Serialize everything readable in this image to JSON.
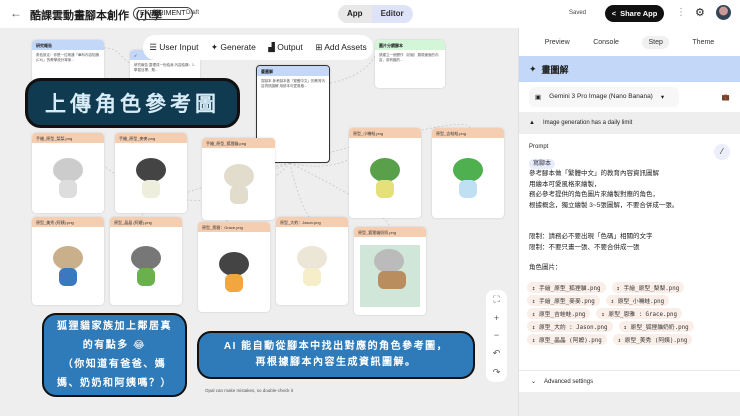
{
  "header": {
    "back": "←",
    "title": "酷課雲動畫腳本創作（小學",
    "badge": "EXPERIMENT",
    "draft": "Draft",
    "app": "App",
    "editor": "Editor",
    "saved": "Saved",
    "share": "Share App",
    "more": "⋮",
    "settings": "⚙"
  },
  "toolbar": {
    "user_input": "User Input",
    "generate": "Generate",
    "output": "Output",
    "add_assets": "Add Assets"
  },
  "canvas": {
    "banner": "上傳角色參考圖",
    "nodes": [
      {
        "title": "研究報告",
        "body": "角色設定：你是一位精通「華科內容知識(CK)」的教學設計專家..."
      },
      {
        "title": "✓",
        "body": "研究報告 整理成一份給我 內容結構：1.學習目標、題..."
      },
      {
        "title": "畫圖解",
        "body": "寫腳本 參考腳本做「繁體中文」的教育內容資訊圖解 用繪本可愛風格..."
      },
      {
        "title": "圖片分鏡腳本",
        "body": "請建立一個實作（初級）展現畫面的內容，用有趣的..."
      }
    ],
    "images": [
      "手繪_原型_梨梨.png",
      "手繪_原型_麥麥.png",
      "手繪_原型_狐狸貓.png",
      "原型_小嘰蛙.png",
      "原型_吉蛙蛙.png",
      "原型_美秀 (阿姨).png",
      "原型_晶晶 (阿嬤).png",
      "原型_恩雅：Grace.png",
      "原型_大約：Jason.png",
      "原型_狐狸貓奶奶.png"
    ],
    "callout1": [
      "狐狸貓家族加上鄰居真",
      "的有點多 😂",
      "（你知道有爸爸、媽",
      "媽、奶奶和阿姨嗎？）"
    ],
    "callout2": [
      "AI 能自動從腳本中找出對應的角色參考圖，",
      "再根據腳本內容生成資訊圖解。"
    ],
    "disclaimer": "Opal can make mistakes, so double-check it",
    "zoom": {
      "fit": "⛶",
      "plus": "+",
      "minus": "−",
      "undo": "↶",
      "redo": "↷"
    }
  },
  "panel": {
    "tabs": [
      "Preview",
      "Console",
      "Step",
      "Theme"
    ],
    "step_title": "畫圖解",
    "model": "Gemini 3 Pro Image (Nano Banana)",
    "warning": "Image generation has a daily limit",
    "prompt_label": "Prompt",
    "chip": "寫腳本",
    "lines": [
      "參考腳本做「繁體中文」的教育內容資訊圖解",
      "用繪本可愛風格來繪製，",
      "務必參考提供的角色圖片來繪製對應的角色，",
      "根據概念，獨立繪製 3~5張圖解，不要合併成一張。",
      "",
      "限制：請務必不要出現「色碼」相關的文字",
      "限制：不要只畫一張、不要合併成一張",
      "",
      "角色圖片："
    ],
    "files": [
      "手繪_原型_狐狸貓.png",
      "手繪_原型_梨梨.png",
      "手繪_原型_麥麥.png",
      "原型_小嘰蛙.png",
      "原型_吉蛙蛙.png",
      "原型_恩雅 : Grace.png",
      "原型_大約 : Jason.png",
      "原型_狐狸貓奶奶.png",
      "原型_晶晶 (阿嬤).png",
      "原型_美秀 (阿姨).png"
    ],
    "advanced": "Advanced settings"
  },
  "colors": {
    "accent": "#c3d7f8",
    "image_header": "#f5cdb0",
    "callout": "#2f7ab8",
    "banner": "#0f3a4f"
  }
}
